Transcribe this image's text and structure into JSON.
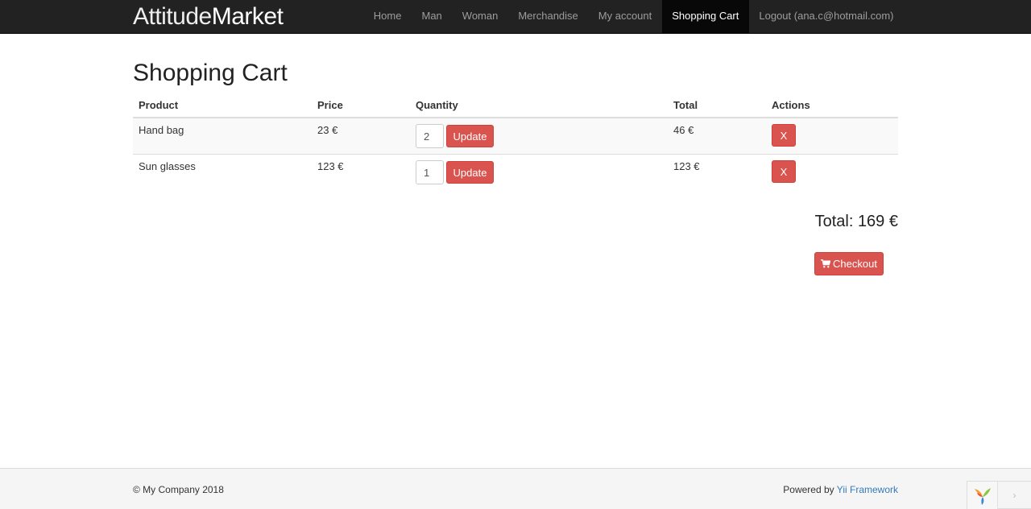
{
  "brand": {
    "light": "Attitude",
    "bold": "Market"
  },
  "nav": {
    "home": "Home",
    "man": "Man",
    "woman": "Woman",
    "merchandise": "Merchandise",
    "account": "My account",
    "cart": "Shopping Cart",
    "logout": "Logout (ana.c@hotmail.com)"
  },
  "page": {
    "title": "Shopping Cart"
  },
  "table": {
    "headers": {
      "product": "Product",
      "price": "Price",
      "quantity": "Quantity",
      "total": "Total",
      "actions": "Actions"
    },
    "rows": [
      {
        "product": "Hand bag",
        "price": "23 €",
        "quantity": "2",
        "update": "Update",
        "total": "46 €",
        "remove": "X"
      },
      {
        "product": "Sun glasses",
        "price": "123 €",
        "quantity": "1",
        "update": "Update",
        "total": "123 €",
        "remove": "X"
      }
    ]
  },
  "summary": {
    "total": "Total: 169 €",
    "checkout": "Checkout"
  },
  "footer": {
    "copyright": "© My Company 2018",
    "powered": "Powered by ",
    "framework": "Yii Framework"
  },
  "debug": {
    "arrow": "›"
  },
  "colors": {
    "navbar": "#222222",
    "danger": "#d9534f",
    "link": "#337ab7"
  }
}
